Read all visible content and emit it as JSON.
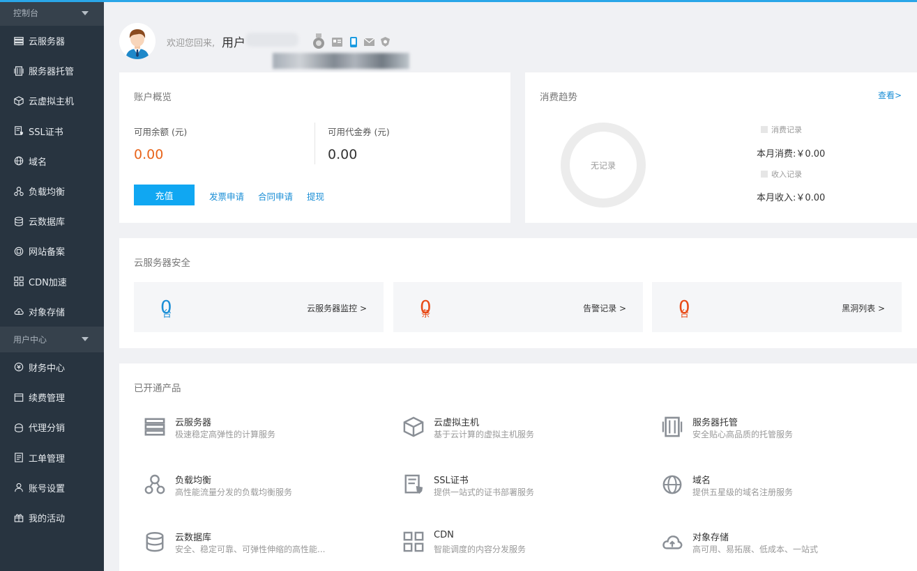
{
  "sidebar": {
    "groups": [
      {
        "label": "控制台"
      },
      {
        "label": "用户中心"
      }
    ],
    "console_items": [
      {
        "label": "云服务器",
        "icon": "server-icon"
      },
      {
        "label": "服务器托管",
        "icon": "server-rack-icon"
      },
      {
        "label": "云虚拟主机",
        "icon": "cube-icon"
      },
      {
        "label": "SSL证书",
        "icon": "certificate-icon"
      },
      {
        "label": "域名",
        "icon": "globe-icon"
      },
      {
        "label": "负载均衡",
        "icon": "load-balance-icon"
      },
      {
        "label": "云数据库",
        "icon": "database-icon"
      },
      {
        "label": "网站备案",
        "icon": "record-icon"
      },
      {
        "label": "CDN加速",
        "icon": "cdn-icon"
      },
      {
        "label": "对象存储",
        "icon": "cloud-upload-icon"
      }
    ],
    "user_items": [
      {
        "label": "财务中心",
        "icon": "finance-icon"
      },
      {
        "label": "续费管理",
        "icon": "renew-icon"
      },
      {
        "label": "代理分销",
        "icon": "agent-icon"
      },
      {
        "label": "工单管理",
        "icon": "ticket-icon"
      },
      {
        "label": "账号设置",
        "icon": "user-icon"
      },
      {
        "label": "我的活动",
        "icon": "gift-icon"
      }
    ]
  },
  "welcome": {
    "greeting": "欢迎您回来,",
    "user": "用户"
  },
  "account": {
    "title": "账户概览",
    "balance_label": "可用余额 (元)",
    "balance": "0.00",
    "voucher_label": "可用代金券 (元)",
    "voucher": "0.00",
    "recharge": "充值",
    "links": [
      "发票申请",
      "合同申请",
      "提现"
    ]
  },
  "trend": {
    "title": "消费趋势",
    "view": "查看>",
    "empty": "无记录",
    "legend_spend": "消费记录",
    "legend_income": "收入记录",
    "month_spend": "本月消费:￥0.00",
    "month_income": "本月收入:￥0.00"
  },
  "security": {
    "title": "云服务器安全",
    "boxes": [
      {
        "num": "0",
        "unit": "台",
        "link": "云服务器监控 >",
        "color": "#1a8ed6"
      },
      {
        "num": "0",
        "unit": "条",
        "link": "告警记录 >",
        "color": "#e84a17"
      },
      {
        "num": "0",
        "unit": "台",
        "link": "黑洞列表 >",
        "color": "#e84a17"
      }
    ]
  },
  "products": {
    "title": "已开通产品",
    "items": [
      {
        "name": "云服务器",
        "desc": "极速稳定高弹性的计算服务",
        "icon": "server-icon"
      },
      {
        "name": "云虚拟主机",
        "desc": "基于云计算的虚拟主机服务",
        "icon": "cube-icon"
      },
      {
        "name": "服务器托管",
        "desc": "安全贴心高品质的托管服务",
        "icon": "server-rack-icon"
      },
      {
        "name": "负载均衡",
        "desc": "高性能流量分发的负载均衡服务",
        "icon": "load-balance-icon"
      },
      {
        "name": "SSL证书",
        "desc": "提供一站式的证书部署服务",
        "icon": "certificate-icon"
      },
      {
        "name": "域名",
        "desc": "提供五星级的域名注册服务",
        "icon": "globe-icon"
      },
      {
        "name": "云数据库",
        "desc": "安全、稳定可靠、可弹性伸缩的高性能...",
        "icon": "database-icon"
      },
      {
        "name": "CDN",
        "desc": "智能调度的内容分发服务",
        "icon": "cdn-icon"
      },
      {
        "name": "对象存储",
        "desc": "高可用、易拓展、低成本、一站式",
        "icon": "cloud-upload-icon"
      }
    ]
  },
  "colors": {
    "accent": "#10a7f2",
    "warning": "#e84a17",
    "sidebar": "#283440"
  }
}
